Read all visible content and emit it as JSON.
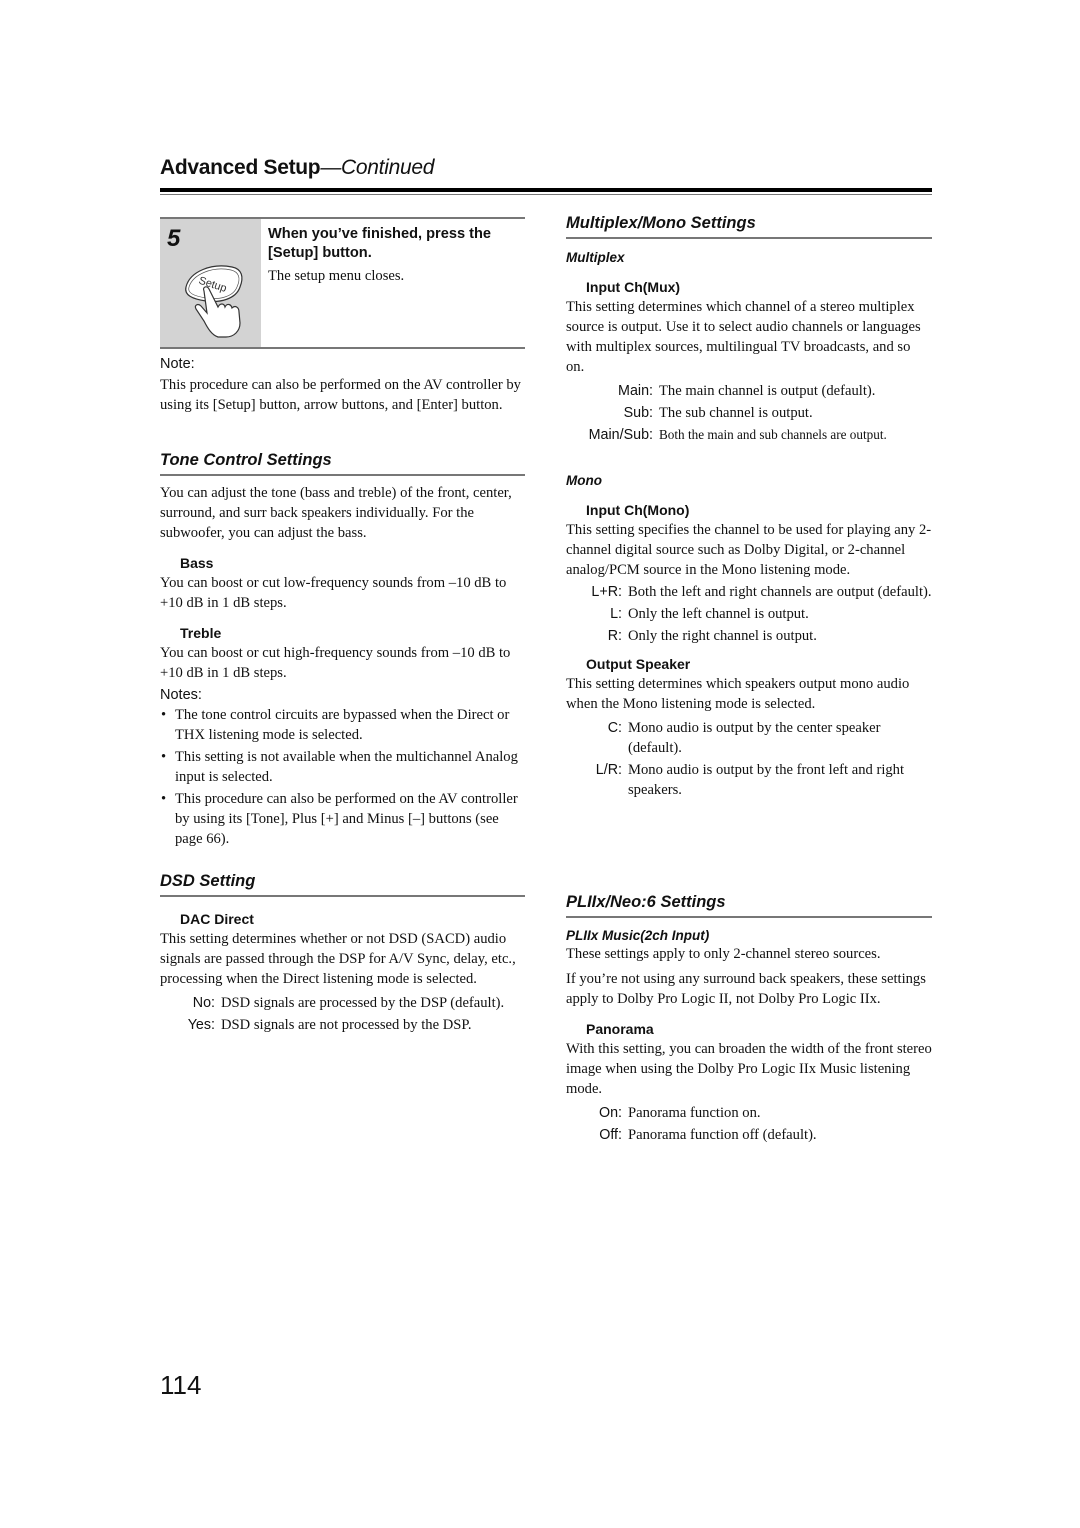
{
  "header": {
    "title": "Advanced Setup",
    "continued": "—Continued"
  },
  "step": {
    "number": "5",
    "icon": "setup-button-press-icon",
    "icon_label": "Setup",
    "instruction": "When you’ve finished, press the [Setup] button.",
    "result": "The setup menu closes."
  },
  "note": {
    "label": "Note:",
    "text": "This procedure can also be performed on the AV controller by using its [Setup] button, arrow buttons, and [Enter] button."
  },
  "tone": {
    "heading": "Tone Control Settings",
    "intro": "You can adjust the tone (bass and treble) of the front, center, surround, and surr back speakers individually. For the subwoofer, you can adjust the bass.",
    "bass": {
      "label": "Bass",
      "text": "You can boost or cut low-frequency sounds from –10 dB to +10 dB in 1 dB steps."
    },
    "treble": {
      "label": "Treble",
      "text": "You can boost or cut high-frequency sounds from –10 dB to +10 dB in 1 dB steps."
    },
    "notes_label": "Notes:",
    "notes": [
      "The tone control circuits are bypassed when the Direct or THX listening mode is selected.",
      "This setting is not available when the multichannel Analog input is selected.",
      "This procedure can also be performed on the AV controller by using its [Tone], Plus [+] and Minus [–] buttons (see page 66)."
    ]
  },
  "dsd": {
    "heading": "DSD Setting",
    "dac_direct": {
      "label": "DAC Direct",
      "text": "This setting determines whether or not DSD (SACD) audio signals are passed through the DSP for A/V Sync, delay, etc., processing when the Direct listening mode is selected.",
      "options": [
        {
          "key": "No:",
          "value": "DSD signals are processed by the DSP (default)."
        },
        {
          "key": "Yes:",
          "value": "DSD signals are not processed by the DSP."
        }
      ]
    }
  },
  "multiplex_mono": {
    "heading": "Multiplex/Mono Settings",
    "multiplex": {
      "subheading": "Multiplex",
      "input_ch_mux": {
        "label": "Input Ch(Mux)",
        "text": "This setting determines which channel of a stereo multiplex source is output. Use it to select audio channels or languages with multiplex sources, multilingual TV broadcasts, and so on.",
        "options": [
          {
            "key": "Main:",
            "value": "The main channel is output (default)."
          },
          {
            "key": "Sub:",
            "value": "The sub channel is output."
          },
          {
            "key": "Main/Sub:",
            "value": "Both the main and sub channels are output."
          }
        ]
      }
    },
    "mono": {
      "subheading": "Mono",
      "input_ch_mono": {
        "label": "Input Ch(Mono)",
        "text": "This setting specifies the channel to be used for playing any 2-channel digital source such as Dolby Digital, or 2-channel analog/PCM source in the Mono listening mode.",
        "options": [
          {
            "key": "L+R:",
            "value": "Both the left and right channels are output (default)."
          },
          {
            "key": "L:",
            "value": "Only the left channel is output."
          },
          {
            "key": "R:",
            "value": "Only the right channel is output."
          }
        ]
      },
      "output_speaker": {
        "label": "Output Speaker",
        "text": "This setting determines which speakers output mono audio when the Mono listening mode is selected.",
        "options": [
          {
            "key": "C:",
            "value": "Mono audio is output by the center speaker (default)."
          },
          {
            "key": "L/R:",
            "value": "Mono audio is output by the front left and right speakers."
          }
        ]
      }
    }
  },
  "pliix": {
    "heading": "PLIIx/Neo:6 Settings",
    "subheading": "PLIIx Music(2ch Input)",
    "para1": "These settings apply to only 2-channel stereo sources.",
    "para2": "If you’re not using any surround back speakers, these settings apply to Dolby Pro Logic II, not Dolby Pro Logic IIx.",
    "panorama": {
      "label": "Panorama",
      "text": "With this setting, you can broaden the width of the front stereo image when using the Dolby Pro Logic IIx Music listening mode.",
      "options": [
        {
          "key": "On:",
          "value": "Panorama function on."
        },
        {
          "key": "Off:",
          "value": "Panorama function off (default)."
        }
      ]
    }
  },
  "page_number": "114"
}
